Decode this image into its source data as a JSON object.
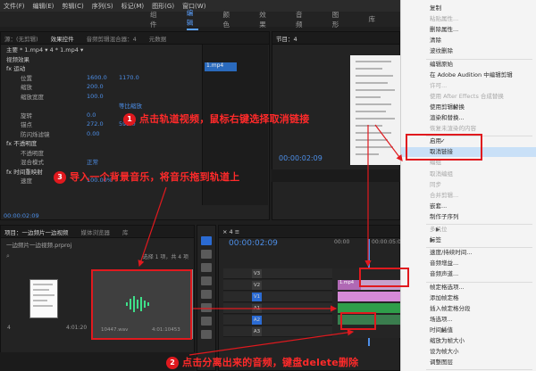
{
  "menubar": [
    "文件(F)",
    "编辑(E)",
    "剪辑(C)",
    "序列(S)",
    "标记(M)",
    "图形(G)",
    "窗口(W)"
  ],
  "workspaces": [
    "组件",
    "编辑",
    "颜色",
    "效果",
    "音频",
    "图形",
    "库"
  ],
  "effects_panel": {
    "tabs": [
      "源：(无剪辑)",
      "效果控件",
      "音频剪辑混合器：4",
      "元数据"
    ],
    "clip_path": "主要 * 1.mp4 ▾  4 * 1.mp4 ▾",
    "clip_label": "1.mp4",
    "section": "视频效果",
    "rows": [
      {
        "name": "fx  运动",
        "v1": "",
        "v2": ""
      },
      {
        "name": "位置",
        "v1": "1600.0",
        "v2": "1170.0"
      },
      {
        "name": "缩放",
        "v1": "200.0",
        "v2": ""
      },
      {
        "name": "缩放宽度",
        "v1": "100.0",
        "v2": ""
      },
      {
        "name": "",
        "v1": "",
        "v2": "等比缩放"
      },
      {
        "name": "旋转",
        "v1": "0.0",
        "v2": ""
      },
      {
        "name": "锚点",
        "v1": "272.0",
        "v2": "592.0"
      },
      {
        "name": "防闪烁滤镜",
        "v1": "0.00",
        "v2": ""
      },
      {
        "name": "fx  不透明度",
        "v1": "",
        "v2": ""
      },
      {
        "name": "不透明度",
        "v1": "",
        "v2": ""
      },
      {
        "name": "混合模式",
        "v1": "正常",
        "v2": ""
      },
      {
        "name": "fx  时间重映射",
        "v1": "",
        "v2": ""
      },
      {
        "name": "速度",
        "v1": "100.00%",
        "v2": ""
      }
    ],
    "timecode": "00:00:02:09"
  },
  "program": {
    "title": "节目：4",
    "timecode": "00:00:02:09"
  },
  "project": {
    "tabs": [
      "项目：一边频片一边视频",
      "媒体浏览器",
      "库"
    ],
    "file": "一边频片一边视频.prproj",
    "count": "选择 1 项，共 4 项",
    "thumb1_label": "4",
    "thumb1_duration": "4:01:20",
    "thumb2_label": "10447.wav",
    "thumb2_duration": "4:01:10453"
  },
  "timeline": {
    "title": "×  4 ≡",
    "timecode": "00:00:02:09",
    "ruler": [
      "00:00",
      "00:00:05:00"
    ],
    "tracks": [
      "V3",
      "V2",
      "V1",
      "A1",
      "A2",
      "A3"
    ],
    "clip_label": "1.mp4"
  },
  "context_menu": {
    "items": [
      {
        "label": "复制",
        "state": "normal"
      },
      {
        "label": "粘贴属性...",
        "state": "disabled"
      },
      {
        "label": "删除属性...",
        "state": "normal"
      },
      {
        "label": "清除",
        "state": "normal"
      },
      {
        "label": "波纹删除",
        "state": "normal"
      },
      {
        "label": "编辑原始",
        "state": "normal"
      },
      {
        "label": "在 Adobe Audition 中编辑剪辑",
        "state": "normal"
      },
      {
        "label": "许可...",
        "state": "disabled"
      },
      {
        "label": "使用 After Effects 合成替换",
        "state": "disabled"
      },
      {
        "label": "使用剪辑替换",
        "state": "normal",
        "submenu": true
      },
      {
        "label": "渲染和替换...",
        "state": "normal"
      },
      {
        "label": "恢复未渲染的内容",
        "state": "disabled"
      },
      {
        "label": "启用",
        "state": "normal",
        "checked": true
      },
      {
        "label": "取消链接",
        "state": "highlight"
      },
      {
        "label": "编组",
        "state": "disabled"
      },
      {
        "label": "取消编组",
        "state": "disabled"
      },
      {
        "label": "同步",
        "state": "disabled"
      },
      {
        "label": "合并剪辑...",
        "state": "disabled"
      },
      {
        "label": "嵌套...",
        "state": "normal"
      },
      {
        "label": "制作子序列",
        "state": "normal"
      },
      {
        "label": "多机位",
        "state": "disabled",
        "submenu": true
      },
      {
        "label": "标签",
        "state": "normal",
        "submenu": true
      },
      {
        "label": "速度/持续时间...",
        "state": "normal"
      },
      {
        "label": "音频增益...",
        "state": "normal"
      },
      {
        "label": "音频声道...",
        "state": "normal"
      },
      {
        "label": "帧定格选项...",
        "state": "normal"
      },
      {
        "label": "添加帧定格",
        "state": "normal"
      },
      {
        "label": "插入帧定格分段",
        "state": "normal"
      },
      {
        "label": "场选项...",
        "state": "normal"
      },
      {
        "label": "时间插值",
        "state": "normal",
        "submenu": true
      },
      {
        "label": "缩放为帧大小",
        "state": "normal"
      },
      {
        "label": "设为帧大小",
        "state": "normal"
      },
      {
        "label": "调整图层",
        "state": "normal"
      }
    ]
  },
  "annotations": [
    {
      "num": "1",
      "text": "点击轨道视频，鼠标右键选择取消链接"
    },
    {
      "num": "3",
      "text": "导入一个背景音乐，将音乐拖到轨道上"
    },
    {
      "num": "2",
      "text": "点击分离出来的音频，键盘delete删除"
    }
  ],
  "colors": {
    "annotation": "#e0191e",
    "accent": "#4d8fe8",
    "video_clip": "#b069b5",
    "audio_clip": "#2f9e4a"
  }
}
